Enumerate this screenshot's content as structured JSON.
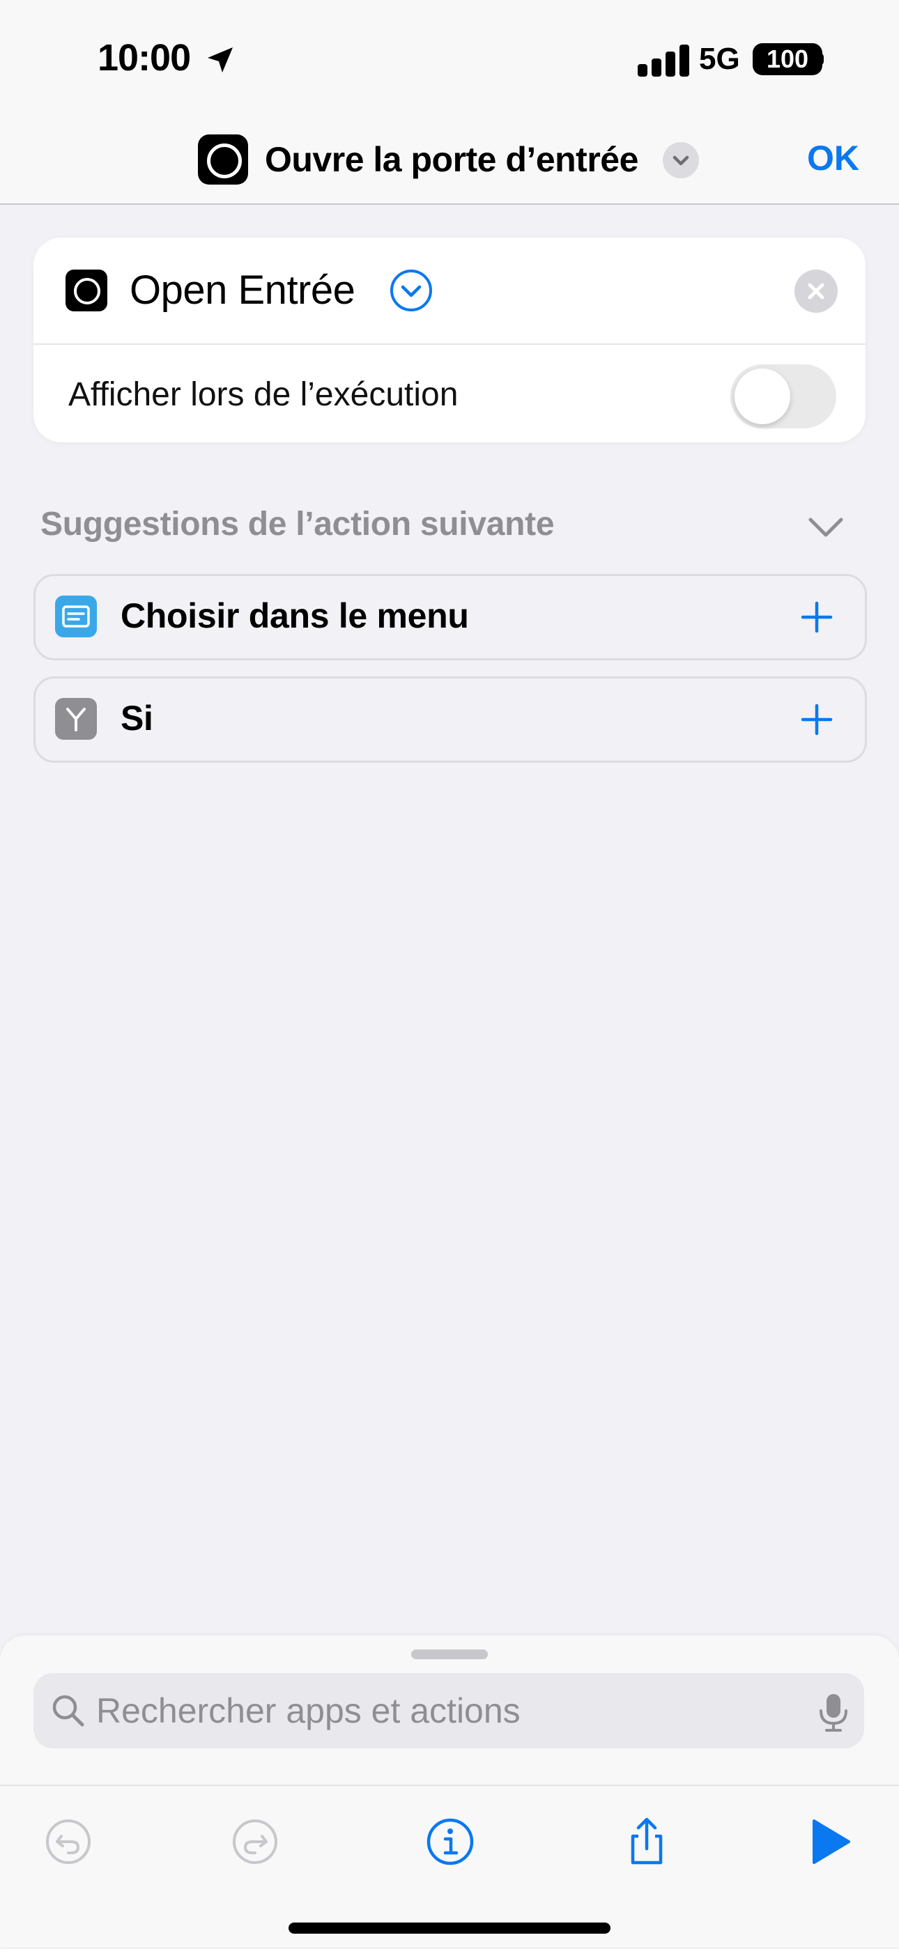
{
  "status_bar": {
    "time": "10:00",
    "network": "5G",
    "battery": "100"
  },
  "header": {
    "title": "Ouvre la porte d’entrée",
    "done_label": "OK"
  },
  "action": {
    "title": "Open Entrée",
    "show_when_run_label": "Afficher lors de l’exécution",
    "show_when_run": false
  },
  "suggestions": {
    "title": "Suggestions de l’action suivante",
    "items": [
      {
        "label": "Choisir dans le menu",
        "icon": "menu-icon",
        "color": "#3aa8e8"
      },
      {
        "label": "Si",
        "icon": "branch-icon",
        "color": "#8e8e93"
      }
    ]
  },
  "search": {
    "placeholder": "Rechercher apps et actions",
    "value": ""
  },
  "colors": {
    "accent": "#0a78f0",
    "background": "#f1f1f6"
  }
}
